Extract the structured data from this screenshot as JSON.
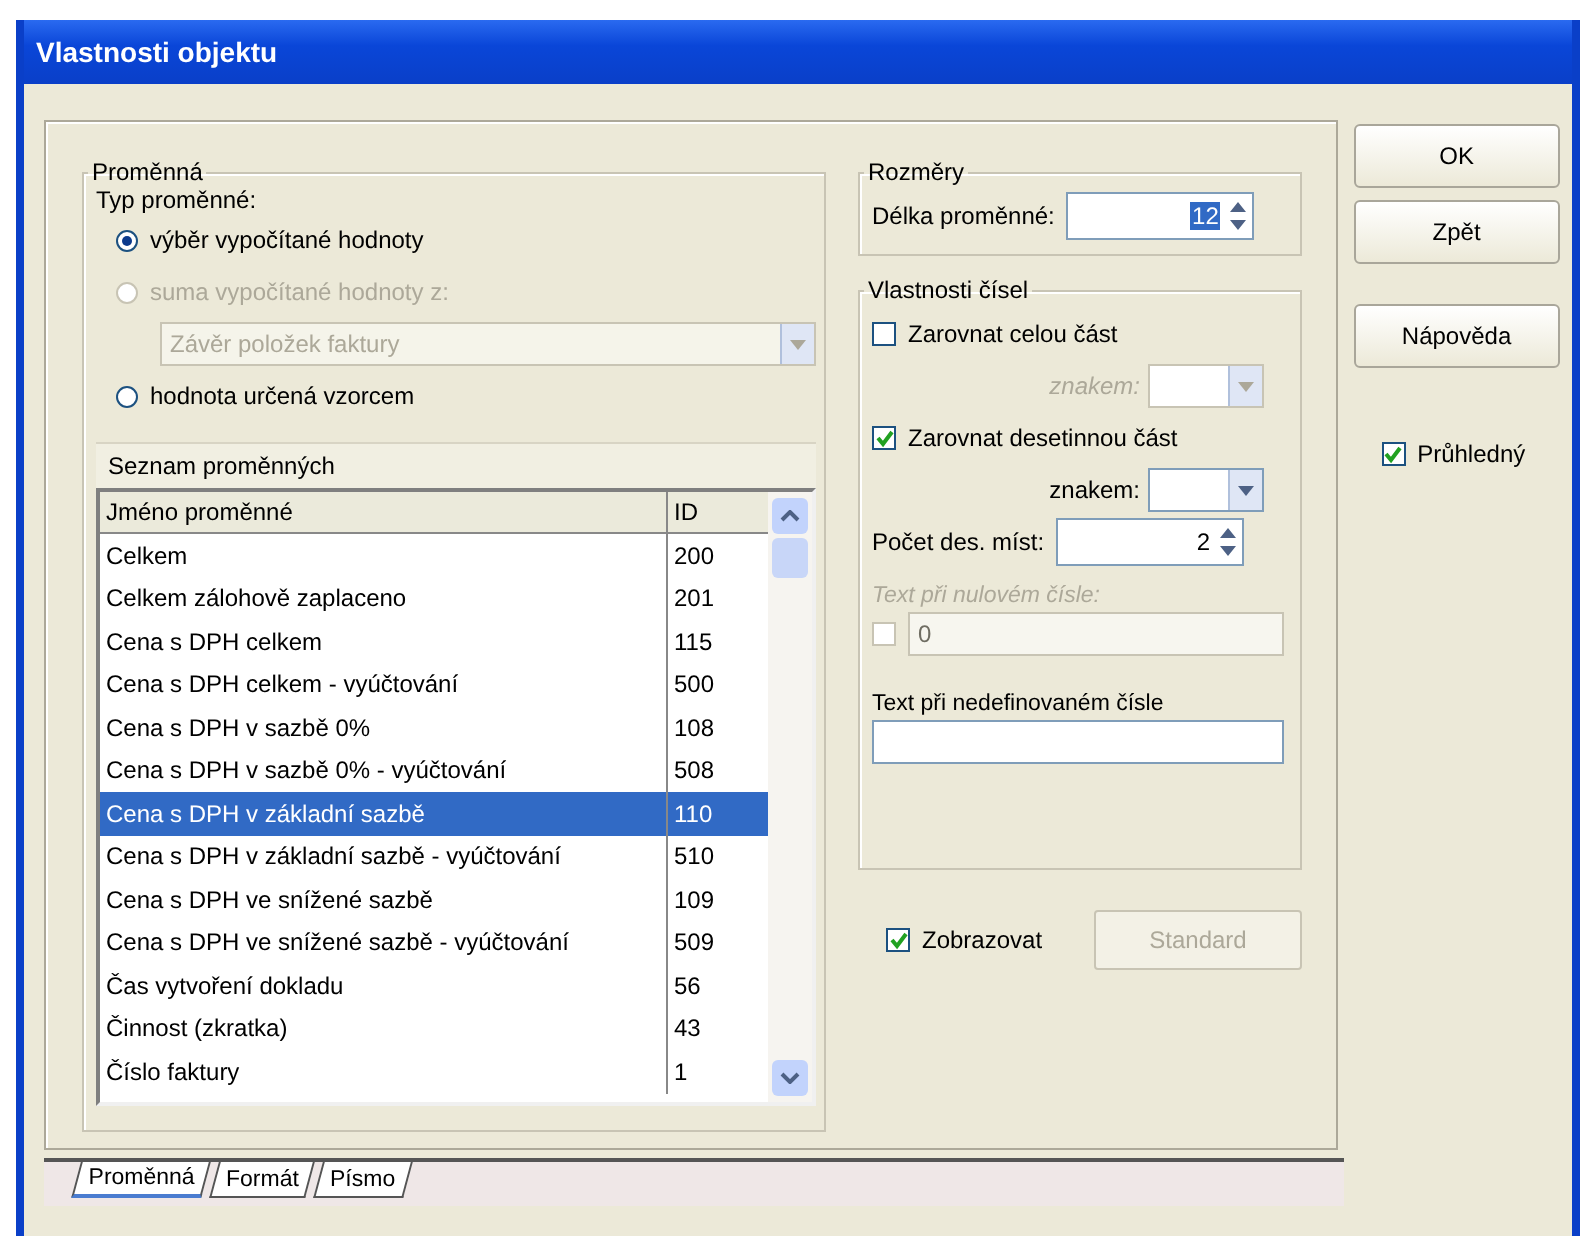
{
  "window": {
    "title": "Vlastnosti objektu"
  },
  "variable_panel": {
    "legend": "Proměnná",
    "type_label": "Typ proměnné:",
    "type_items": [
      {
        "kind": "radio",
        "label": "výběr vypočítané hodnoty",
        "selected": true,
        "disabled": false
      },
      {
        "kind": "radio",
        "label": "suma vypočítané hodnoty z:",
        "selected": false,
        "disabled": true
      },
      {
        "kind": "combo",
        "value": "Závěr položek faktury",
        "disabled": true
      },
      {
        "kind": "radio",
        "label": "hodnota určená vzorcem",
        "selected": false,
        "disabled": false
      }
    ]
  },
  "variable_list": {
    "title": "Seznam proměnných",
    "columns": [
      "Jméno proměnné",
      "ID"
    ],
    "rows": [
      {
        "name": "Celkem",
        "id": "200",
        "selected": false
      },
      {
        "name": "Celkem zálohově zaplaceno",
        "id": "201",
        "selected": false
      },
      {
        "name": "Cena s DPH celkem",
        "id": "115",
        "selected": false
      },
      {
        "name": "Cena s DPH celkem - vyúčtování",
        "id": "500",
        "selected": false
      },
      {
        "name": "Cena s DPH v sazbě 0%",
        "id": "108",
        "selected": false
      },
      {
        "name": "Cena s DPH v sazbě 0% - vyúčtování",
        "id": "508",
        "selected": false
      },
      {
        "name": "Cena s DPH v základní sazbě",
        "id": "110",
        "selected": true
      },
      {
        "name": "Cena s DPH v základní sazbě - vyúčtování",
        "id": "510",
        "selected": false
      },
      {
        "name": "Cena s DPH ve snížené sazbě",
        "id": "109",
        "selected": false
      },
      {
        "name": "Cena s DPH ve snížené sazbě - vyúčtování",
        "id": "509",
        "selected": false
      },
      {
        "name": "Čas vytvoření dokladu",
        "id": "56",
        "selected": false
      },
      {
        "name": "Činnost (zkratka)",
        "id": "43",
        "selected": false
      },
      {
        "name": "Číslo faktury",
        "id": "1",
        "selected": false
      }
    ]
  },
  "dimensions": {
    "legend": "Rozměry",
    "length_label": "Délka proměnné:",
    "length_value": "12"
  },
  "number_props": {
    "legend": "Vlastnosti čísel",
    "rows": [
      {
        "kind": "check",
        "label": "Zarovnat celou část",
        "checked": false,
        "disabled": false
      },
      {
        "kind": "char",
        "label": "znakem:",
        "disabled": true
      },
      {
        "kind": "check",
        "label": "Zarovnat desetinnou část",
        "checked": true,
        "disabled": false
      },
      {
        "kind": "char",
        "label": "znakem:",
        "disabled": false
      },
      {
        "kind": "spin",
        "label": "Počet des. míst:",
        "value": "2"
      },
      {
        "kind": "checked_text",
        "label": "Text při nulovém čísle:",
        "value": "0",
        "checked": false,
        "disabled": true
      },
      {
        "kind": "text",
        "label": "Text při nedefinovaném čísle"
      }
    ]
  },
  "show": {
    "label": "Zobrazovat",
    "checked": true
  },
  "standard_button": {
    "label": "Standard",
    "disabled": true
  },
  "buttons": [
    {
      "label": "OK"
    },
    {
      "label": "Zpět"
    },
    {
      "label": "Nápověda"
    }
  ],
  "transparent": {
    "label": "Průhledný",
    "checked": true
  },
  "tabs": [
    {
      "label": "Proměnná",
      "selected": true
    },
    {
      "label": "Formát",
      "selected": false
    },
    {
      "label": "Písmo",
      "selected": false
    }
  ]
}
